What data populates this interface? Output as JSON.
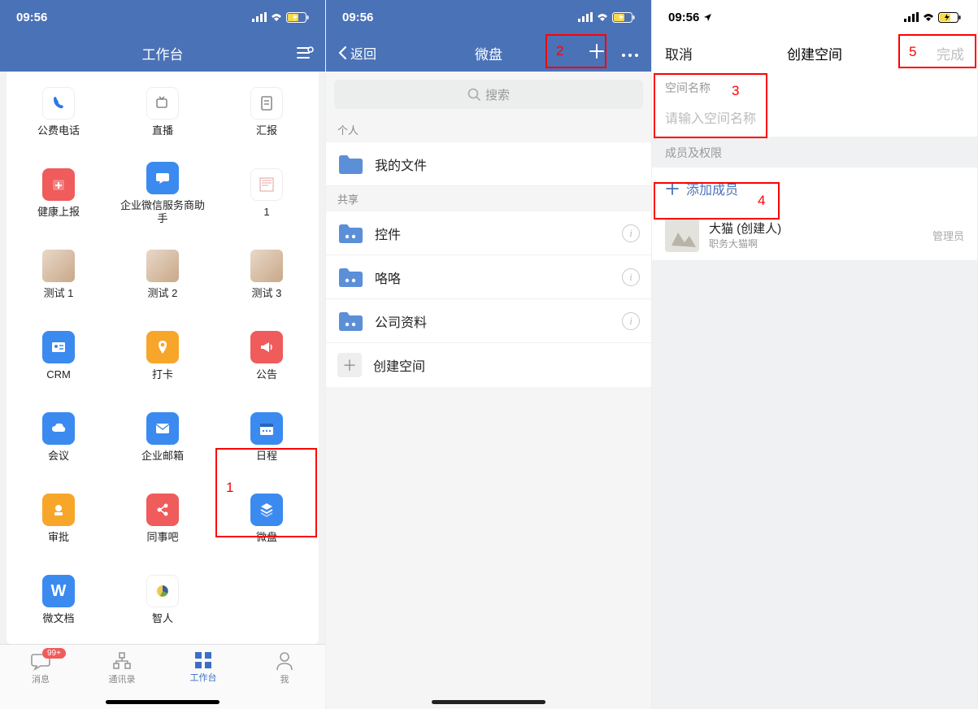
{
  "status": {
    "time": "09:56",
    "time_loc": "09:56"
  },
  "annotations": {
    "n1": "1",
    "n2": "2",
    "n3": "3",
    "n4": "4",
    "n5": "5"
  },
  "phone1": {
    "title": "工作台",
    "apps": [
      [
        {
          "label": "公费电话",
          "color": "#fff",
          "fg": "#2a7be4",
          "icon": "phone"
        },
        {
          "label": "直播",
          "color": "#fff",
          "fg": "#8a8a8a",
          "icon": "live"
        },
        {
          "label": "汇报",
          "color": "#fff",
          "fg": "#8a8a8a",
          "icon": "report"
        }
      ],
      [
        {
          "label": "健康上报",
          "color": "#f05b5b",
          "icon": "plus-cal"
        },
        {
          "label": "企业微信服务商助手",
          "color": "#3b8af0",
          "icon": "chat"
        },
        {
          "label": "1",
          "color": "#fff",
          "icon": "page",
          "fg": "#d88"
        }
      ],
      [
        {
          "label": "测试 1",
          "img": true
        },
        {
          "label": "测试 2",
          "img": true
        },
        {
          "label": "测试 3",
          "img": true
        }
      ],
      [
        {
          "label": "CRM",
          "color": "#3b8af0",
          "icon": "card"
        },
        {
          "label": "打卡",
          "color": "#f7a62a",
          "icon": "pin"
        },
        {
          "label": "公告",
          "color": "#f05b5b",
          "icon": "horn"
        }
      ],
      [
        {
          "label": "会议",
          "color": "#3b8af0",
          "icon": "cloud"
        },
        {
          "label": "企业邮箱",
          "color": "#3b8af0",
          "icon": "mail"
        },
        {
          "label": "日程",
          "color": "#3b8af0",
          "icon": "cal"
        }
      ],
      [
        {
          "label": "审批",
          "color": "#f7a62a",
          "icon": "stamp"
        },
        {
          "label": "同事吧",
          "color": "#f05b5b",
          "icon": "share"
        },
        {
          "label": "微盘",
          "color": "#3b8af0",
          "icon": "disk"
        }
      ],
      [
        {
          "label": "微文档",
          "color": "#3b8af0",
          "icon": "W",
          "text": "W"
        },
        {
          "label": "智人",
          "color": "#fff",
          "icon": "pie",
          "fg": "#666"
        },
        {
          "label": "",
          "empty": true
        }
      ]
    ],
    "tabs": {
      "msg": "消息",
      "msg_badge": "99+",
      "contacts": "通讯录",
      "workbench": "工作台",
      "me": "我"
    }
  },
  "phone2": {
    "back": "返回",
    "title": "微盘",
    "search_placeholder": "搜索",
    "sect_personal": "个人",
    "sect_shared": "共享",
    "my_files": "我的文件",
    "items": [
      {
        "label": "控件"
      },
      {
        "label": "咯咯"
      },
      {
        "label": "公司资料"
      }
    ],
    "create_space": "创建空间"
  },
  "phone3": {
    "cancel": "取消",
    "title": "创建空间",
    "done": "完成",
    "name_label": "空间名称",
    "name_placeholder": "请输入空间名称",
    "members_label": "成员及权限",
    "add_member": "添加成员",
    "member": {
      "name": "大猫 (创建人)",
      "sub": "职务大猫啊",
      "role": "管理员"
    }
  }
}
